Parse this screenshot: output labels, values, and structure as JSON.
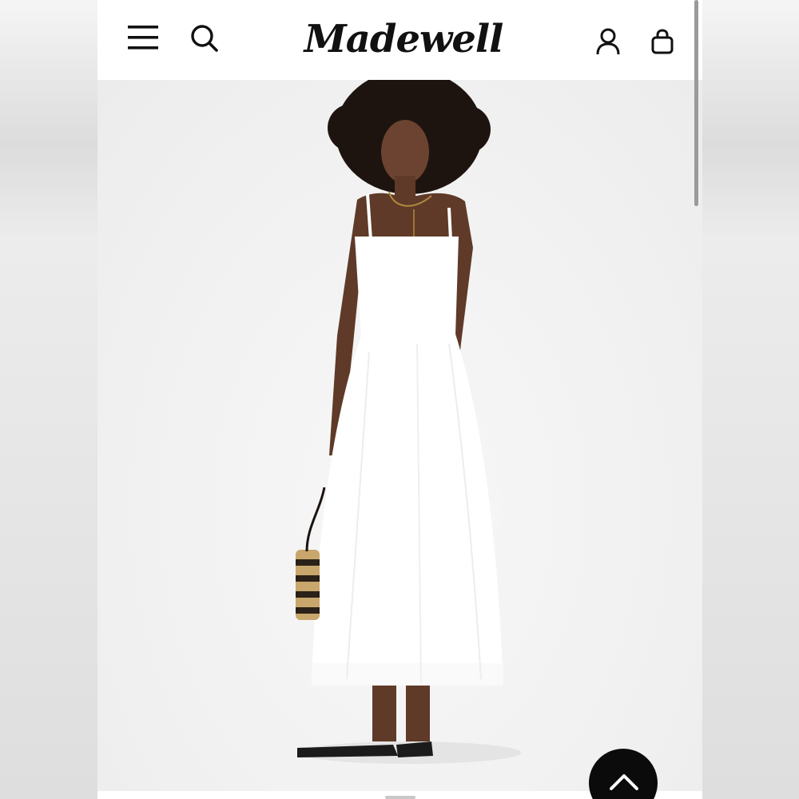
{
  "header": {
    "brand": "Madewell",
    "icons": {
      "menu": "hamburger-menu-icon",
      "search": "search-icon",
      "account": "account-icon",
      "bag": "shopping-bag-icon"
    }
  },
  "product_image": {
    "subject": "model-in-white-midi-dress",
    "colors": {
      "background": "#f3f3f3",
      "dress": "#ffffff",
      "hair": "#1d1410"
    }
  },
  "controls": {
    "back_to_top_icon": "chevron-up-icon"
  },
  "colors": {
    "header_bg": "#ffffff",
    "icon": "#111111",
    "accent_button": "#0b0b0b"
  }
}
